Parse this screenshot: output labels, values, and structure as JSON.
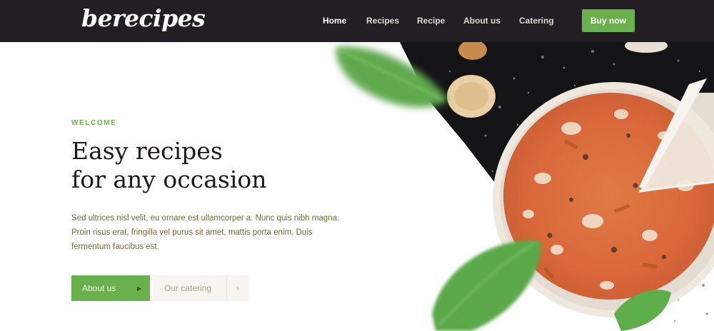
{
  "header": {
    "logo_text": "berecipes",
    "nav": [
      {
        "label": "Home",
        "active": true
      },
      {
        "label": "Recipes",
        "active": false
      },
      {
        "label": "Recipe",
        "active": false
      },
      {
        "label": "About us",
        "active": false
      },
      {
        "label": "Catering",
        "active": false
      }
    ],
    "cta_label": "Buy now"
  },
  "hero": {
    "eyebrow": "WELCOME",
    "headline_line1": "Easy recipes",
    "headline_line2": "for any occasion",
    "body": "Sed ultrices nisl velit, eu ornare est ullamcorper a. Nunc quis nibh magna. Proin risus erat, fringilla vel purus sit amet, mattis porta enim. Duis fermentum faucibus est.",
    "primary_button": {
      "label": "About us",
      "icon": "chevron-right-icon"
    },
    "secondary_button": {
      "label": "Our catering",
      "icon": "chevron-right-icon"
    },
    "image": "pizza-photo"
  },
  "colors": {
    "header_bg": "#231e24",
    "accent_green": "#6ab04c",
    "headline": "#1c1a16",
    "body_text": "#6e6a3b"
  }
}
